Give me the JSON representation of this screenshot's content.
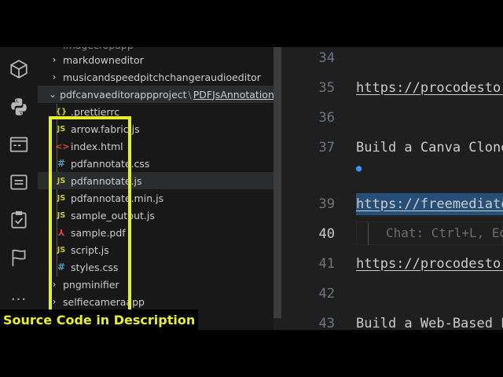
{
  "activity_bar": {
    "icons": [
      "extensions-icon",
      "python-icon",
      "terminal-panel-icon",
      "remote-explorer-icon",
      "testing-icon",
      "bookmark-flag-icon",
      "more-icon"
    ],
    "more_label": "..."
  },
  "explorer": {
    "partial_top": "imagecropapp",
    "items": [
      {
        "label": "markdowneditor",
        "chev": "›"
      },
      {
        "label": "musicandspeedpitchchangeraudioeditor",
        "chev": "›"
      },
      {
        "label": "pdfcanvaeditorappproject",
        "path_sep": "\\",
        "path_tail": "PDFJsAnnotations-...",
        "chev": "⌄"
      },
      {
        "label": ".prettierrc",
        "icon": "{}"
      },
      {
        "label": "arrow.fabric.js",
        "icon": "JS"
      },
      {
        "label": "index.html",
        "icon": "<>"
      },
      {
        "label": "pdfannotate.css",
        "icon": "#"
      },
      {
        "label": "pdfannotate.js",
        "icon": "JS"
      },
      {
        "label": "pdfannotate.min.js",
        "icon": "JS"
      },
      {
        "label": "sample_output.js",
        "icon": "JS"
      },
      {
        "label": "sample.pdf",
        "icon": "⅄"
      },
      {
        "label": "script.js",
        "icon": "JS"
      },
      {
        "label": "styles.css",
        "icon": "#"
      },
      {
        "label": "pngminifier",
        "chev": "›"
      },
      {
        "label": "selfiecameraapp",
        "chev": "›"
      }
    ]
  },
  "editor": {
    "lines": [
      {
        "num": "34",
        "text": ""
      },
      {
        "num": "35",
        "text": "https://procodestore.com/"
      },
      {
        "num": "36",
        "text": ""
      },
      {
        "num": "37",
        "text": "Build a Canva Clone"
      },
      {
        "num": "39",
        "text": "https://freemediatools.com/"
      },
      {
        "num": "40",
        "text": ""
      },
      {
        "num": "41",
        "text": "https://procodestore.com/"
      },
      {
        "num": "42",
        "text": ""
      },
      {
        "num": "43",
        "text": "Build a Web-Based PDF"
      }
    ],
    "inline_hint": "Chat: Ctrl+L, Ed",
    "lightbulb": "●"
  },
  "caption": {
    "text": "Source Code in  Description"
  },
  "colors": {
    "highlight": "#e6f02d",
    "accent": "#3794ff",
    "selection": "#264f78"
  }
}
